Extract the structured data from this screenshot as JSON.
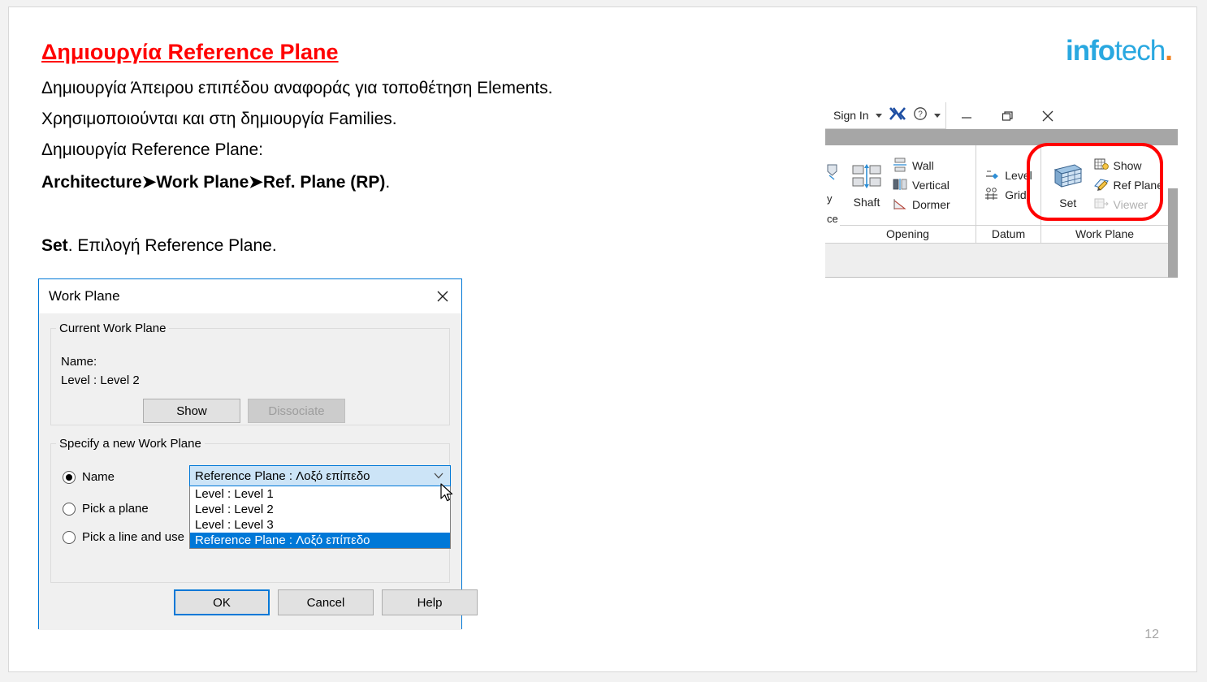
{
  "slide": {
    "title": "Δημιουργία Reference Plane",
    "lines": [
      "Δημιουργία Άπειρου επιπέδου αναφοράς για τοποθέτηση Elements.",
      "Χρησιμοποιούνται και στη δημιουργία Families.",
      "Δημιουργία Reference Plane:"
    ],
    "path_line": "Architecture➤Work Plane➤Ref. Plane (RP)",
    "path_line_tail": ".",
    "set_lead": "Set",
    "set_rest": ". Επιλογή Reference Plane.",
    "page_number": "12"
  },
  "logo": {
    "bold_part": "info",
    "light_part": "tech",
    "dot": ".",
    "blue": "#29a8e0",
    "orange": "#f08122"
  },
  "dialog": {
    "title": "Work Plane",
    "close_icon": "close-icon",
    "current_group": {
      "legend": "Current Work Plane",
      "name_label": "Name:",
      "level_value": "Level : Level 2",
      "show_button": "Show",
      "dissociate_button": "Dissociate"
    },
    "specify_group": {
      "legend": "Specify a new Work Plane",
      "radios": [
        {
          "label": "Name",
          "checked": true
        },
        {
          "label": "Pick a plane",
          "checked": false
        },
        {
          "label": "Pick a line and use",
          "checked": false
        }
      ],
      "combo": {
        "value": "Reference Plane : Λοξό επίπεδο",
        "expanded": true,
        "options": [
          {
            "label": "Level : Level 1",
            "selected": false
          },
          {
            "label": "Level : Level 2",
            "selected": false
          },
          {
            "label": "Level : Level 3",
            "selected": false
          },
          {
            "label": "Reference Plane : Λοξό επίπεδο",
            "selected": true
          }
        ],
        "highlight_color": "#0078d7"
      }
    },
    "footer": {
      "ok": "OK",
      "cancel": "Cancel",
      "help": "Help"
    }
  },
  "ribbon": {
    "sign_in": "Sign In",
    "help_icon": "question-mark-icon",
    "exchange_icon": "autodesk-exchange-icon",
    "minimize_icon": "minimize-icon",
    "restore_icon": "restore-icon",
    "close_icon": "close-icon",
    "left_cut_labels": [
      "y",
      "ce"
    ],
    "panels": [
      {
        "title": "Opening",
        "big_button": {
          "label": "Shaft",
          "icon": "shaft-icon"
        },
        "small_buttons": [
          {
            "label": "Wall",
            "icon": "wall-opening-icon",
            "disabled": false
          },
          {
            "label": "Vertical",
            "icon": "vertical-opening-icon",
            "disabled": false
          },
          {
            "label": "Dormer",
            "icon": "dormer-opening-icon",
            "disabled": false
          }
        ]
      },
      {
        "title": "Datum",
        "small_buttons": [
          {
            "label": "Level",
            "icon": "level-icon",
            "disabled": false
          },
          {
            "label": "Grid",
            "icon": "grid-icon",
            "disabled": false
          }
        ]
      },
      {
        "title": "Work Plane",
        "big_button": {
          "label": "Set",
          "icon": "set-work-plane-icon"
        },
        "small_buttons": [
          {
            "label": "Show",
            "icon": "show-work-plane-icon",
            "disabled": false
          },
          {
            "label": "Ref  Plane",
            "icon": "ref-plane-icon",
            "disabled": false
          },
          {
            "label": "Viewer",
            "icon": "work-plane-viewer-icon",
            "disabled": true
          }
        ]
      }
    ],
    "highlight_color": "#ff0000"
  }
}
